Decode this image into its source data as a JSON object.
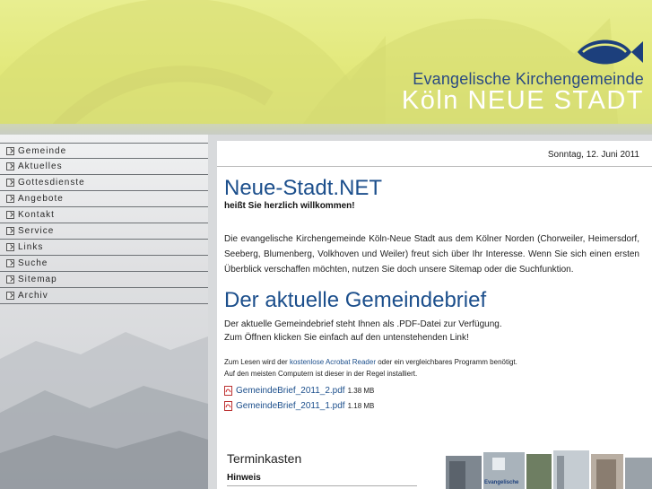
{
  "header": {
    "org_name_line1": "Evangelische Kirchengemeinde",
    "org_name_line2": "Köln NEUE STADT",
    "logo_icon": "ichthys-fish-icon"
  },
  "nav": {
    "items": [
      {
        "label": "Gemeinde"
      },
      {
        "label": "Aktuelles"
      },
      {
        "label": "Gottesdienste"
      },
      {
        "label": "Angebote"
      },
      {
        "label": "Kontakt"
      },
      {
        "label": "Service"
      },
      {
        "label": "Links"
      },
      {
        "label": "Suche"
      },
      {
        "label": "Sitemap"
      },
      {
        "label": "Archiv"
      }
    ]
  },
  "main": {
    "date": "Sonntag, 12. Juni 2011",
    "title": "Neue-Stadt.NET",
    "welcome": "heißt Sie herzlich willkommen!",
    "intro": "Die evangelische Kirchengemeinde Köln-Neue Stadt aus dem Kölner Norden (Chorweiler, Heimersdorf, Seeberg, Blumenberg, Volkhoven und Weiler) freut sich über Ihr Interesse. Wenn Sie sich einen ersten Überblick verschaffen möchten, nutzen Sie doch unsere Sitemap oder die Suchfunktion.",
    "brief_title": "Der aktuelle Gemeindebrief",
    "brief_line1": "Der aktuelle Gemeindebrief steht Ihnen als .PDF-Datei zur Verfügung.",
    "brief_line2": "Zum Öffnen klicken Sie einfach auf den untenstehenden Link!",
    "reader_note_prefix": "Zum Lesen wird der",
    "reader_link": "kostenlose Acrobat Reader",
    "reader_note_suffix": "oder ein vergleichbares Programm benötigt.",
    "reader_note_line2": "Auf den meisten Computern ist dieser in der Regel installiert.",
    "files": [
      {
        "name": "GemeindeBrief_2011_2.pdf",
        "size": "1.38 MB"
      },
      {
        "name": "GemeindeBrief_2011_1.pdf",
        "size": "1.18 MB"
      }
    ],
    "termin_title": "Terminkasten",
    "termin_hinweis": "Hinweis",
    "flyer_text": "Evangelische"
  },
  "colors": {
    "accent_blue": "#1c4f8c",
    "header_yellow": "#e4ea80"
  }
}
